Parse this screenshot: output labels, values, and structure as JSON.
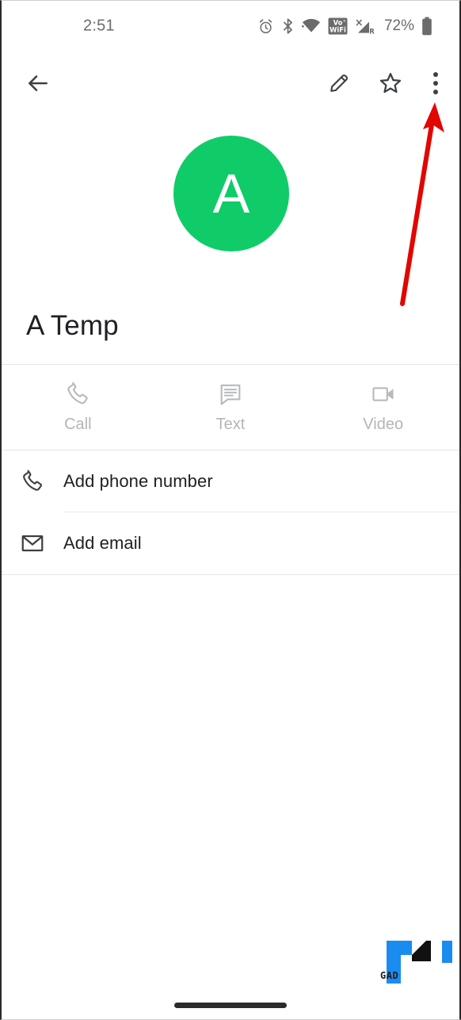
{
  "status_bar": {
    "time": "2:51",
    "battery_percent": "72%",
    "icons": [
      "alarm-icon",
      "bluetooth-icon",
      "wifi-icon",
      "vowifi-icon",
      "cellular-signal-icon",
      "battery-icon"
    ],
    "vowifi_label_top": "Vo",
    "vowifi_label_sup": "n",
    "vowifi_label_bottom": "WiFi",
    "signal_x_label": "X",
    "signal_roaming_label": "R"
  },
  "app_bar": {
    "back_icon": "arrow-left-icon",
    "edit_icon": "pencil-icon",
    "favorite_icon": "star-outline-icon",
    "overflow_icon": "more-vertical-icon"
  },
  "contact": {
    "avatar_initial": "A",
    "avatar_color": "#10cc68",
    "name": "A Temp"
  },
  "quick_actions": [
    {
      "label": "Call",
      "icon": "phone-icon"
    },
    {
      "label": "Text",
      "icon": "message-icon"
    },
    {
      "label": "Video",
      "icon": "video-camera-icon"
    }
  ],
  "detail_rows": [
    {
      "label": "Add phone number",
      "icon": "phone-icon"
    },
    {
      "label": "Add email",
      "icon": "envelope-icon"
    }
  ],
  "annotation": {
    "type": "red-arrow",
    "color": "#e10600",
    "points_to": "overflow-menu-button"
  },
  "watermark": {
    "text": "GAD",
    "blue": "#1a8cf0",
    "black": "#111111"
  },
  "gesture_nav": {
    "label": "home-pill"
  }
}
